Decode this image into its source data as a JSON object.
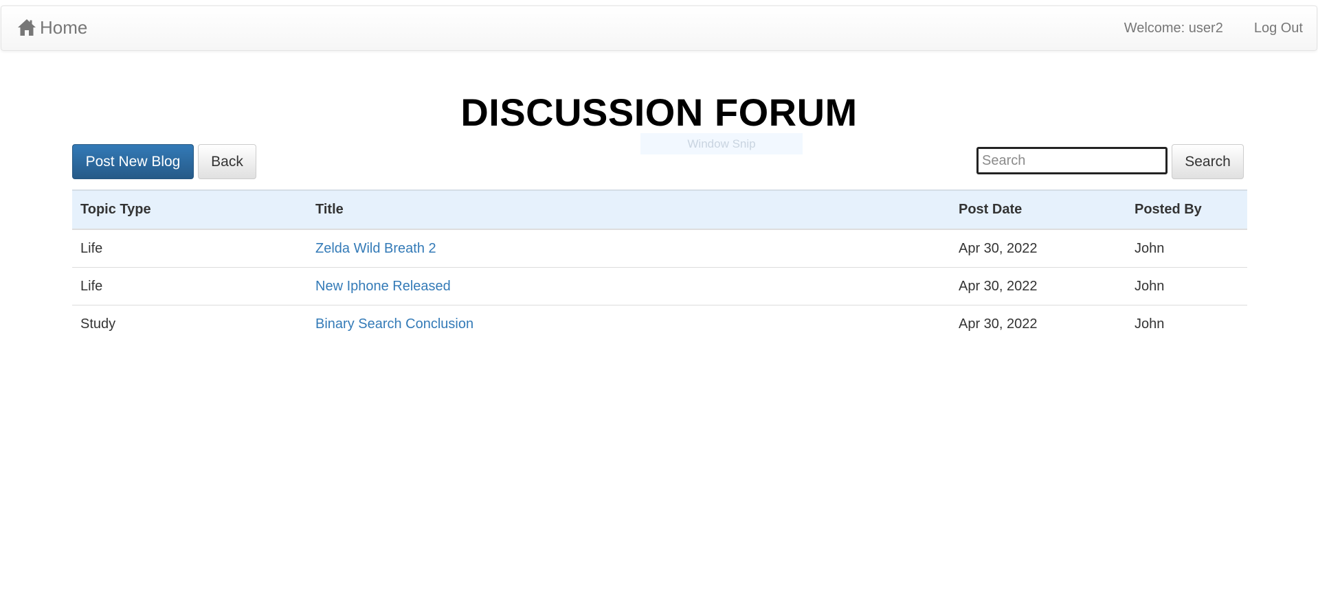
{
  "navbar": {
    "brand_icon": "home-icon",
    "brand_label": "Home",
    "welcome": "Welcome: user2",
    "logout_label": "Log Out"
  },
  "page": {
    "title": "DISCUSSION FORUM"
  },
  "overlay": {
    "label": "Window Snip"
  },
  "toolbar": {
    "post_new_label": "Post New Blog",
    "back_label": "Back",
    "search_placeholder": "Search",
    "search_value": "",
    "search_button_label": "Search"
  },
  "table": {
    "headers": [
      "Topic Type",
      "Title",
      "Post Date",
      "Posted By"
    ],
    "rows": [
      {
        "topic_type": "Life",
        "title": "Zelda Wild Breath 2",
        "post_date": "Apr 30, 2022",
        "posted_by": "John"
      },
      {
        "topic_type": "Life",
        "title": "New Iphone Released",
        "post_date": "Apr 30, 2022",
        "posted_by": "John"
      },
      {
        "topic_type": "Study",
        "title": "Binary Search Conclusion",
        "post_date": "Apr 30, 2022",
        "posted_by": "John"
      }
    ]
  },
  "colors": {
    "primary": "#337ab7",
    "header_bg": "#e6f1fc",
    "link": "#337ab7"
  }
}
